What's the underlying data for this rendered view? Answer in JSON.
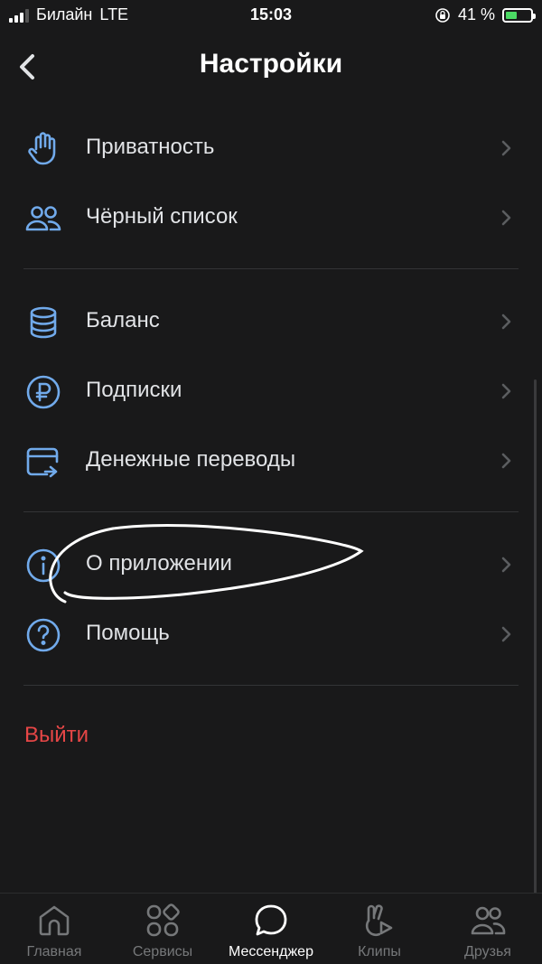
{
  "status_bar": {
    "carrier": "Билайн",
    "network": "LTE",
    "time": "15:03",
    "battery": "41 %"
  },
  "header": {
    "title": "Настройки"
  },
  "groups": [
    {
      "items": [
        {
          "label": "Приватность",
          "icon": "hand-icon"
        },
        {
          "label": "Чёрный список",
          "icon": "users-icon"
        }
      ]
    },
    {
      "items": [
        {
          "label": "Баланс",
          "icon": "coins-stack-icon"
        },
        {
          "label": "Подписки",
          "icon": "ruble-icon"
        },
        {
          "label": "Денежные переводы",
          "icon": "card-transfer-icon"
        }
      ]
    },
    {
      "items": [
        {
          "label": "О приложении",
          "icon": "info-icon"
        },
        {
          "label": "Помощь",
          "icon": "question-icon"
        }
      ]
    }
  ],
  "logout_label": "Выйти",
  "colors": {
    "accent": "#71aaeb",
    "danger": "#e64646",
    "background": "#19191a"
  },
  "tabs": [
    {
      "label": "Главная",
      "icon": "home-icon"
    },
    {
      "label": "Сервисы",
      "icon": "services-icon"
    },
    {
      "label": "Мессенджер",
      "icon": "messenger-icon",
      "active": true
    },
    {
      "label": "Клипы",
      "icon": "clips-icon"
    },
    {
      "label": "Друзья",
      "icon": "friends-icon"
    }
  ]
}
